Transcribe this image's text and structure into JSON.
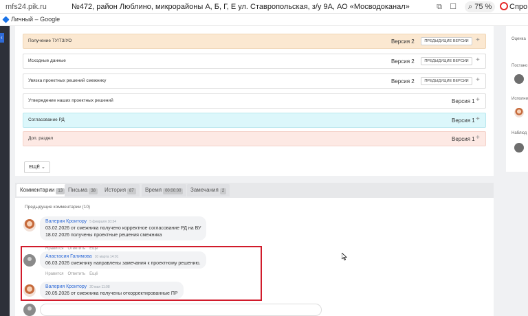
{
  "browser": {
    "url": "mfs24.pik.ru",
    "page_title": "№472, район Люблино, микрорайоны А, Б, Г, Е ул. Ставропольская, з/у 9А, АО «Мосводоканал»",
    "zoom": "75 %",
    "help_label": "Спро",
    "profile_label": "Личный – Google"
  },
  "sections": [
    {
      "name": "Получение ТУ/ТЗ/УО",
      "version": "Версия 2",
      "prev_label": "ПРЕДЫДУЩИЕ ВЕРСИИ",
      "style": "orange"
    },
    {
      "name": "Исходные данные",
      "version": "Версия 2",
      "prev_label": "ПРЕДЫДУЩИЕ ВЕРСИИ",
      "style": "plain"
    },
    {
      "name": "Увязка проектных решений смежнику",
      "version": "Версия 2",
      "prev_label": "ПРЕДЫДУЩИЕ ВЕРСИИ",
      "style": "plain"
    },
    {
      "name": "Утверждение наших проектных решений",
      "version": "Версия 1",
      "style": "plain"
    },
    {
      "name": "Согласование РД",
      "version": "Версия 1",
      "style": "cyan"
    },
    {
      "name": "Доп. раздел",
      "version": "Версия 1",
      "style": "pink"
    }
  ],
  "more_button": "ЕЩЁ",
  "tabs": [
    {
      "label": "Комментарии",
      "count": "13",
      "active": true
    },
    {
      "label": "Письма",
      "count": "38"
    },
    {
      "label": "История",
      "count": "87"
    },
    {
      "label": "Время",
      "count": "00:00:00"
    },
    {
      "label": "Замечания",
      "count": "2"
    }
  ],
  "previous_comments": "Предыдущие комментарии (10)",
  "comments": [
    {
      "author": "Валерия Кроитору",
      "date": "5 февраля 10:34",
      "lines": [
        "03.02.2026 от смежника получено корректное согласование РД на ВУ",
        "18.02.2026 получены проектные решения смежника"
      ],
      "actions": [
        "Нравится",
        "Ответить",
        "Ещё"
      ],
      "avatar": "woman"
    },
    {
      "author": "Анастасия Галимова",
      "date": "10 марта 14:01",
      "lines": [
        "06.03.2026 смежнику направлены замечания к проектному решению."
      ],
      "actions": [
        "Нравится",
        "Ответить",
        "Ещё"
      ],
      "avatar": "grey"
    },
    {
      "author": "Валерия Кроитору",
      "date": "20 мая 11:08",
      "lines": [
        "20.05.2026 от смежника получены откорректированные ПР"
      ],
      "actions": [
        "Нравится",
        "Ответить",
        "Ещё"
      ],
      "avatar": "woman"
    }
  ],
  "right_panel": {
    "rating": "Оценка",
    "set_by": "Постано",
    "executor": "Исполни",
    "observers": "Наблюд"
  },
  "colors": {
    "link": "#2f6bd8",
    "highlight": "#d11b2b",
    "orange_row": "#fbe8d1",
    "cyan_row": "#dcf7fb",
    "pink_row": "#fde9e4"
  }
}
